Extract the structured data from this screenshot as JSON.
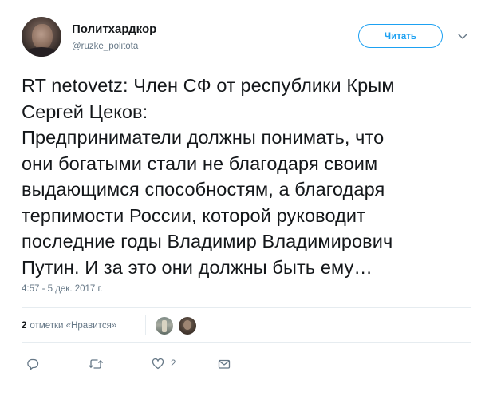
{
  "header": {
    "display_name": "Политхардкор",
    "username": "@ruzke_politota",
    "follow_label": "Читать"
  },
  "tweet": {
    "text": "RT netovetz: Член СФ от республики Крым\nСергей Цеков:\nПредприниматели должны понимать, что\nони богатыми стали не благодаря своим\nвыдающимся способностям, а благодаря\nтерпимости России, которой руководит\nпоследние годы Владимир Владимирович\nПутин. И за это они должны быть ему…",
    "timestamp": "4:57 - 5 дек. 2017 г."
  },
  "stats": {
    "likes_count": "2",
    "likes_label": "отметки «Нравится»"
  },
  "actions": {
    "reply_icon": "reply-icon",
    "retweet_icon": "retweet-icon",
    "like_icon": "heart-icon",
    "like_count": "2",
    "dm_icon": "envelope-icon"
  },
  "colors": {
    "accent": "#1da1f2",
    "text": "#14171a",
    "muted": "#657786",
    "divider": "#e6ecf0"
  }
}
